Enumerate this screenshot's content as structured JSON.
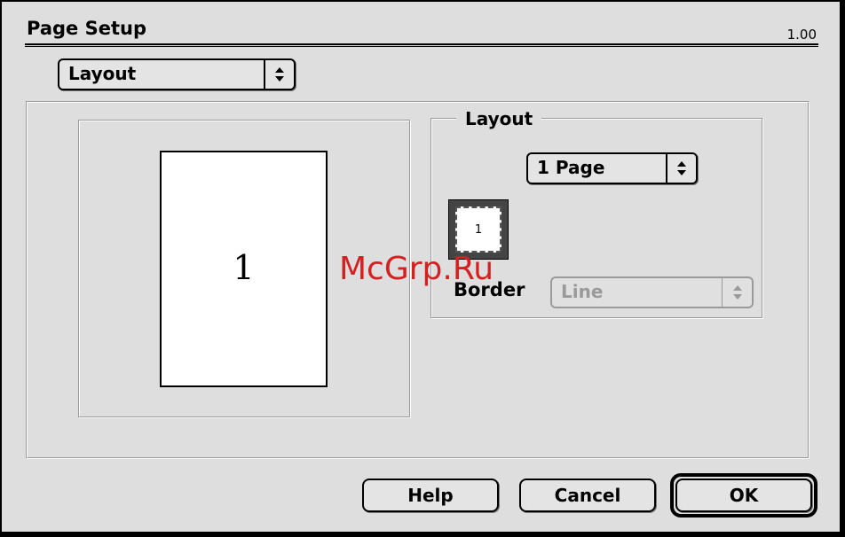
{
  "dialog": {
    "title": "Page Setup",
    "version": "1.00"
  },
  "section_popup": {
    "selected": "Layout",
    "icon": "up-down-arrows-icon"
  },
  "preview": {
    "page_number": "1"
  },
  "layout_group": {
    "legend": "Layout",
    "pages_popup": {
      "selected": "1 Page",
      "icon": "up-down-arrows-icon"
    },
    "thumbnail_number": "1",
    "border_label": "Border",
    "border_popup": {
      "selected": "Line",
      "disabled": true,
      "icon": "up-down-arrows-icon"
    }
  },
  "buttons": {
    "help": "Help",
    "cancel": "Cancel",
    "ok": "OK"
  },
  "watermark": "McGrp.Ru"
}
